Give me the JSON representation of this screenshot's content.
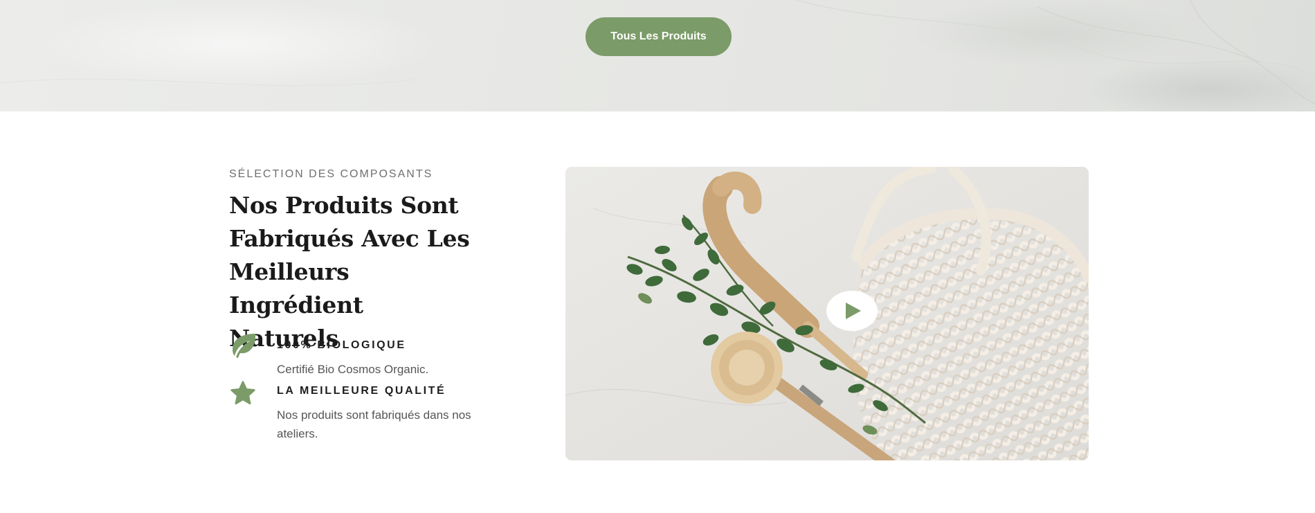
{
  "hero": {
    "button_label": "Tous Les Produits"
  },
  "section": {
    "eyebrow": "SÉLECTION DES COMPOSANTS",
    "heading": "Nos Produits Sont Fabriqués Avec Les Meilleurs Ingrédient Naturels",
    "features": [
      {
        "icon": "leaf-icon",
        "title": "100% BIOLOGIQUE",
        "text": "Certifié Bio Cosmos Organic."
      },
      {
        "icon": "star-icon",
        "title": "LA MEILLEURE QUALITÉ",
        "text": "Nos produits sont fabriqués dans nos ateliers."
      }
    ]
  },
  "video": {
    "play_icon": "play-icon"
  },
  "colors": {
    "accent": "#7b9b68",
    "heading": "#1a1a1a",
    "body_text": "#555555",
    "eyebrow": "#6f6f6f"
  }
}
